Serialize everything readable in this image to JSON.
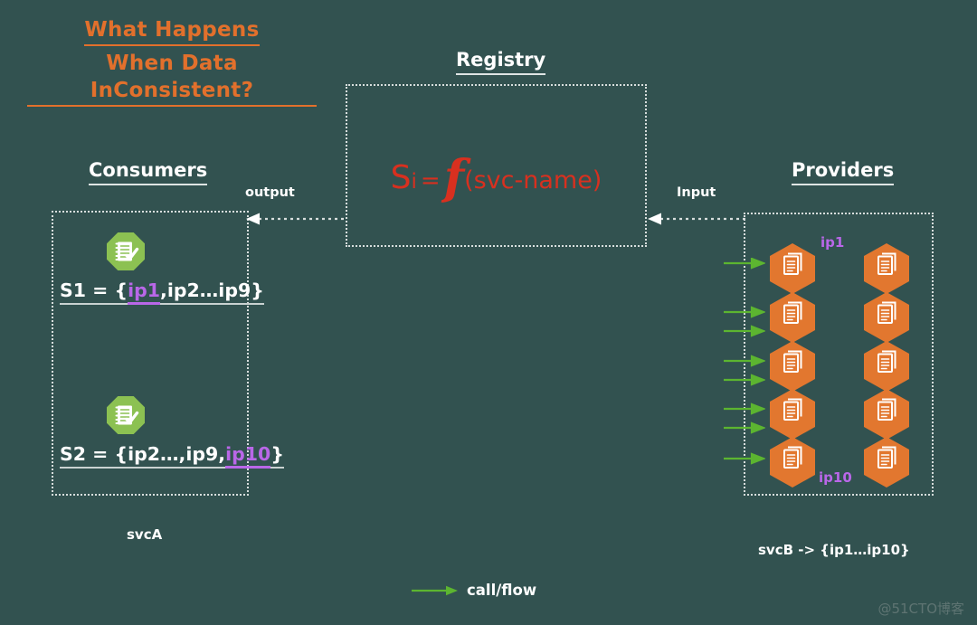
{
  "background_color": "#325250",
  "headline": {
    "line1": "What Happens",
    "line2": "When Data InConsistent?",
    "color": "#e2702c"
  },
  "consumers": {
    "title": "Consumers",
    "caption": "svcA",
    "nodes": [
      {
        "icon": "notepad-check-icon",
        "formula_prefix": "S1 = {",
        "highlight": "ip1",
        "formula_suffix": ",ip2…ip9}",
        "highlight_color": "#b967e8"
      },
      {
        "icon": "notepad-check-icon",
        "formula_prefix": "S2 = {ip2…,ip9,",
        "highlight": "ip10",
        "formula_suffix": "}",
        "highlight_color": "#b967e8"
      }
    ]
  },
  "registry": {
    "title": "Registry",
    "formula": {
      "s": "S",
      "subscript": "i",
      "equals": "=",
      "function": "f",
      "argument": "(svc-name)",
      "color": "#d8301f"
    }
  },
  "providers": {
    "title": "Providers",
    "caption": "svcB -> {ip1…ip10}",
    "label_top": "ip1",
    "label_bottom": "ip10",
    "label_color": "#b967e8",
    "node_icon": "documents-stack-icon",
    "node_color": "#e2772f",
    "rows": 5,
    "columns": 2
  },
  "connectors": {
    "output_label": "output",
    "input_label": "Input",
    "arrow_color": "#d8dedd"
  },
  "legend": {
    "label": "call/flow",
    "arrow_color": "#5cb530"
  },
  "watermark": "@51CTO博客"
}
